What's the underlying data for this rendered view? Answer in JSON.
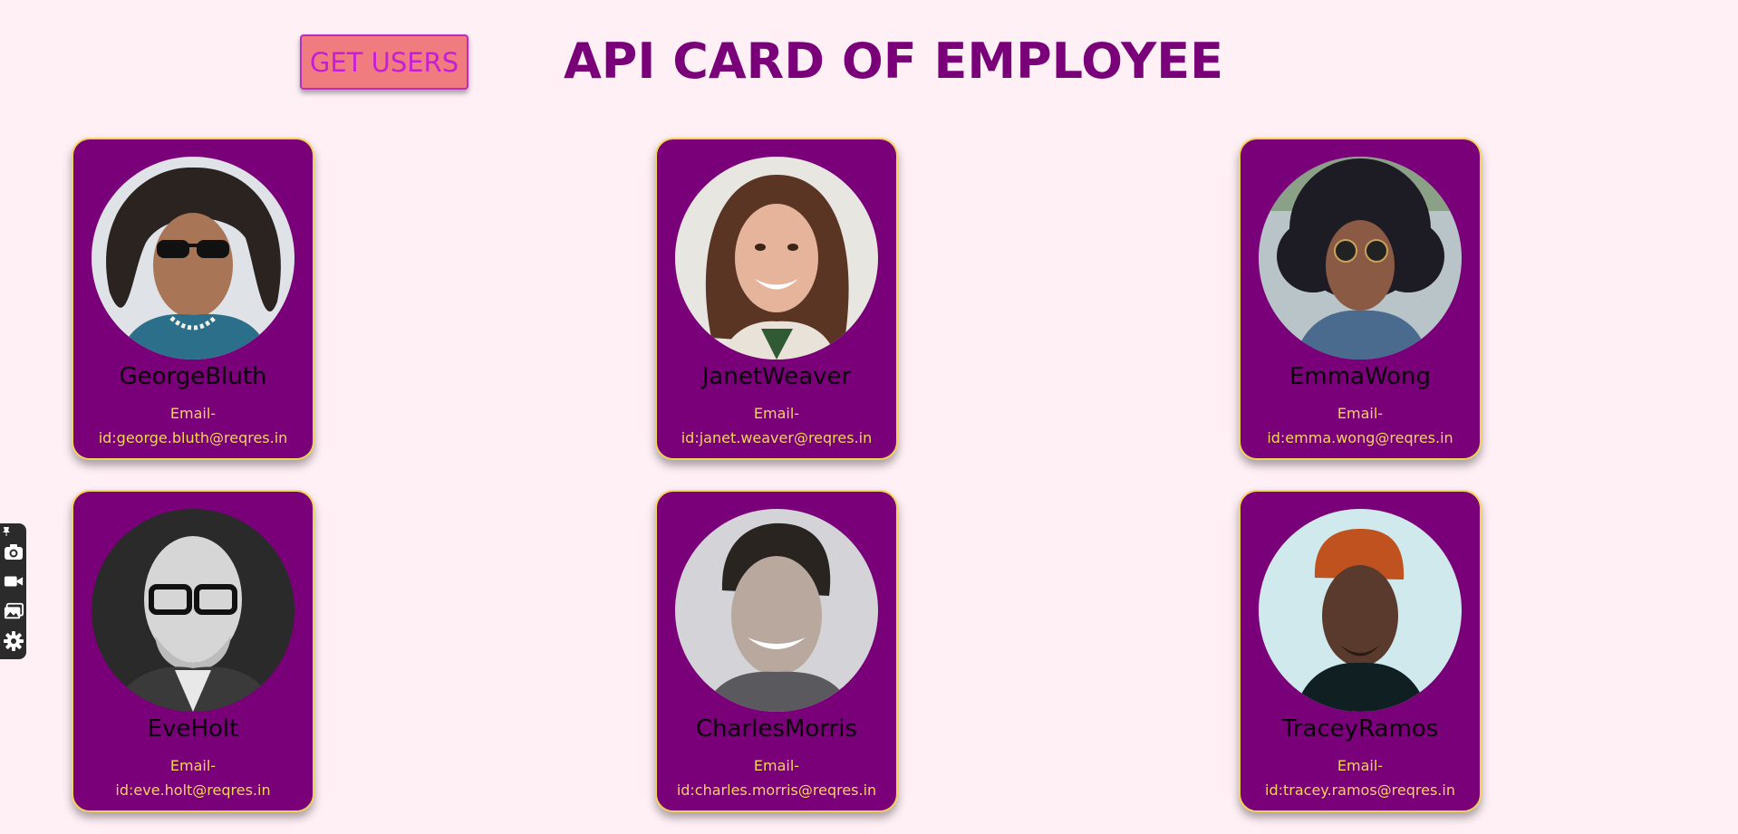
{
  "header": {
    "get_users_label": "GET USERS",
    "title": "API CARD OF EMPLOYEE"
  },
  "colors": {
    "background": "#fff0f6",
    "card": "#7a0079",
    "card_border": "#f2d45b",
    "title": "#7a0079",
    "button_bg": "#f07c80",
    "button_text": "#c41fd6",
    "email_text": "#f2d45b"
  },
  "cards": [
    {
      "name": "GeorgeBluth",
      "email_line1": "Email-",
      "email_line2": "id:george.bluth@reqres.in"
    },
    {
      "name": "JanetWeaver",
      "email_line1": "Email-",
      "email_line2": "id:janet.weaver@reqres.in"
    },
    {
      "name": "EmmaWong",
      "email_line1": "Email-",
      "email_line2": "id:emma.wong@reqres.in"
    },
    {
      "name": "EveHolt",
      "email_line1": "Email-",
      "email_line2": "id:eve.holt@reqres.in"
    },
    {
      "name": "CharlesMorris",
      "email_line1": "Email-",
      "email_line2": "id:charles.morris@reqres.in"
    },
    {
      "name": "TraceyRamos",
      "email_line1": "Email-",
      "email_line2": "id:tracey.ramos@reqres.in"
    }
  ],
  "toolbar": {
    "icons": [
      "pin-icon",
      "camera-icon",
      "video-icon",
      "gallery-icon",
      "gear-icon"
    ]
  }
}
